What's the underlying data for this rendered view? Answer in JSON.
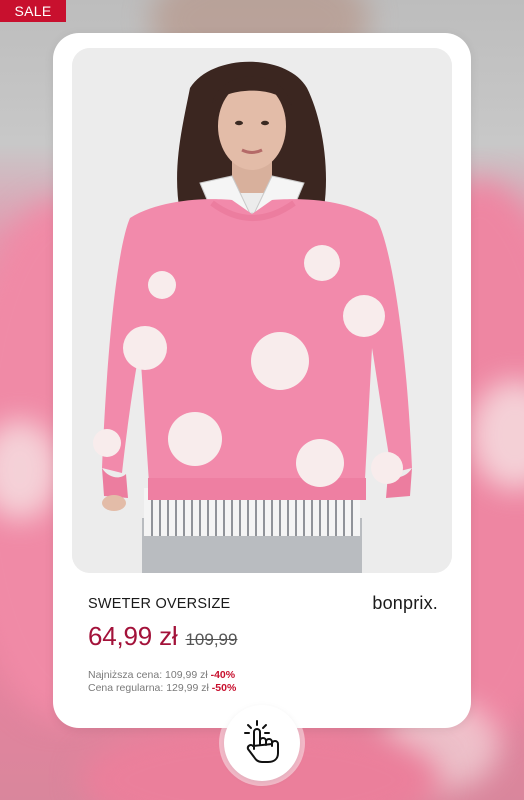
{
  "badge": {
    "label": "SALE"
  },
  "product": {
    "name": "SWETER OVERSIZE",
    "brand": "bonprix.",
    "price_current": "64,99 zł",
    "price_old": "109,99",
    "lowest_price_label": "Najniższa cena: 109,99 zł",
    "lowest_price_discount": "-40%",
    "regular_price_label": "Cena regularna: 129,99 zł",
    "regular_price_discount": "-50%"
  },
  "colors": {
    "sale_red": "#c8102e",
    "price_red": "#a3123a",
    "sweater_pink": "#f28aab"
  },
  "icons": {
    "tap": "hand-pointer-tap-icon"
  }
}
